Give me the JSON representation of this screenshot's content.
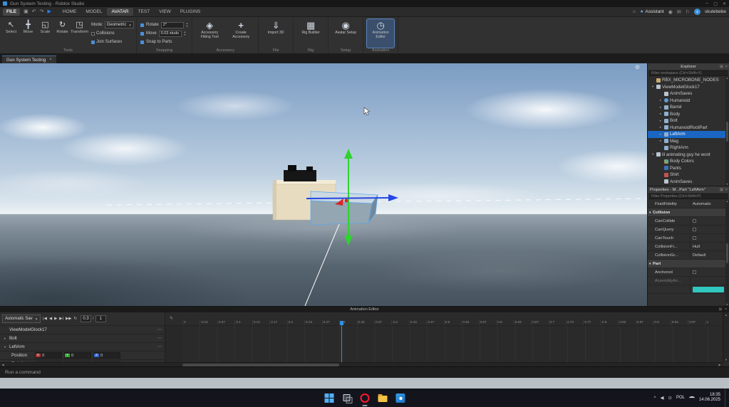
{
  "window": {
    "title": "Gun System Testing - Roblox Studio",
    "controls": {
      "minimize": "─",
      "maximize": "▢",
      "close": "✕"
    }
  },
  "colors": {
    "selection_blue": "#1a66c2",
    "gizmo_green": "#2fd32f",
    "gizmo_blue": "#2446e6",
    "gizmo_red": "#d42a2a",
    "playhead_blue": "#2e8fe8",
    "sky_top": "#7b9cc2",
    "water": "#56646f"
  },
  "menubar": {
    "file_label": "FILE",
    "tabs": [
      {
        "label": "HOME",
        "active": false
      },
      {
        "label": "MODEL",
        "active": false
      },
      {
        "label": "AVATAR",
        "active": true
      },
      {
        "label": "TEST",
        "active": false
      },
      {
        "label": "VIEW",
        "active": false
      },
      {
        "label": "PLUGINS",
        "active": false
      }
    ],
    "assistant_label": "Assistant",
    "username": "skutebebe"
  },
  "ribbon": {
    "groups": {
      "tools": "Tools",
      "snapping": "Snapping",
      "accessory": "Accessory",
      "file": "File",
      "rig": "Rig",
      "setup": "Setup",
      "animation": "Animation"
    },
    "tools": [
      {
        "label": "Select",
        "icon": "select"
      },
      {
        "label": "Move",
        "icon": "move"
      },
      {
        "label": "Scale",
        "icon": "scale"
      },
      {
        "label": "Rotate",
        "icon": "rotate"
      },
      {
        "label": "Transform",
        "icon": "transform"
      }
    ],
    "mode_label": "Mode:",
    "mode_value": "Geometric",
    "collisions_label": "Collisions",
    "collisions_checked": false,
    "join_surfaces_label": "Join Surfaces",
    "join_surfaces_checked": true,
    "snap_rotate_label": "Rotate",
    "snap_rotate_value": "2°",
    "snap_rotate_checked": true,
    "snap_move_label": "Move",
    "snap_move_value": "0.03 studs",
    "snap_move_checked": true,
    "snap_parts_label": "Snap to Parts",
    "snap_parts_checked": true,
    "big_buttons": [
      {
        "label": "Accessory Fitting Tool",
        "icon": "accessory-fitting",
        "active": false
      },
      {
        "label": "Create Accessory",
        "icon": "create-accessory",
        "active": false
      },
      {
        "label": "Import 3D",
        "icon": "import-3d",
        "active": false
      },
      {
        "label": "Rig Builder",
        "icon": "rig-builder",
        "active": false
      },
      {
        "label": "Avatar Setup",
        "icon": "avatar-setup",
        "active": false
      },
      {
        "label": "Animation Editor",
        "icon": "animation-editor",
        "active": true
      }
    ]
  },
  "doc_tab": {
    "label": "Gun System Testing",
    "close_glyph": "×"
  },
  "explorer": {
    "title": "Explorer",
    "filter_placeholder": "Filter workspace (Ctrl+Shift+X)",
    "items": [
      {
        "label": "RBX_MICROBONE_NODES",
        "icon": "folder",
        "depth": 0,
        "expand": "leaf",
        "selected": false
      },
      {
        "label": "ViewModelGlock17",
        "icon": "model",
        "depth": 0,
        "expand": "open",
        "selected": false
      },
      {
        "label": "AnimSaves",
        "icon": "model",
        "depth": 1,
        "expand": "leaf",
        "selected": false
      },
      {
        "label": "Humanoid",
        "icon": "humanoid",
        "depth": 1,
        "expand": "closed",
        "selected": false
      },
      {
        "label": "Barrel",
        "icon": "part",
        "depth": 1,
        "expand": "closed",
        "selected": false
      },
      {
        "label": "Body",
        "icon": "part",
        "depth": 1,
        "expand": "closed",
        "selected": false
      },
      {
        "label": "Bolt",
        "icon": "part",
        "depth": 1,
        "expand": "closed",
        "selected": false
      },
      {
        "label": "HumanoidRootPart",
        "icon": "part",
        "depth": 1,
        "expand": "closed",
        "selected": false
      },
      {
        "label": "LeftArm",
        "icon": "part",
        "depth": 1,
        "expand": "closed",
        "selected": true
      },
      {
        "label": "Mag",
        "icon": "part",
        "depth": 1,
        "expand": "closed",
        "selected": false
      },
      {
        "label": "RightArm",
        "icon": "part",
        "depth": 1,
        "expand": "leaf",
        "selected": false
      },
      {
        "label": "lil animating guy he wont",
        "icon": "model",
        "depth": 0,
        "expand": "open",
        "selected": false
      },
      {
        "label": "Body Colors",
        "icon": "bodycolors",
        "depth": 1,
        "expand": "leaf",
        "selected": false
      },
      {
        "label": "Pants",
        "icon": "pants",
        "depth": 1,
        "expand": "leaf",
        "selected": false
      },
      {
        "label": "Shirt",
        "icon": "shirt",
        "depth": 1,
        "expand": "leaf",
        "selected": false
      },
      {
        "label": "AnimSaves",
        "icon": "model",
        "depth": 1,
        "expand": "leaf",
        "selected": false
      }
    ]
  },
  "properties": {
    "title": "Properties - M...Part \"LeftArm\"",
    "filter_placeholder": "Filter Properties (Ctrl+Shift+P)",
    "rows": [
      {
        "type": "row",
        "label": "FluidFidelity",
        "value": "Automatic"
      },
      {
        "type": "section",
        "label": "Collision"
      },
      {
        "type": "check",
        "label": "CanCollide",
        "checked": false
      },
      {
        "type": "check",
        "label": "CanQuery",
        "checked": false
      },
      {
        "type": "check",
        "label": "CanTouch",
        "checked": false
      },
      {
        "type": "row",
        "label": "CollisionFi...",
        "value": "Hull"
      },
      {
        "type": "row",
        "label": "CollisionGr...",
        "value": "Default"
      },
      {
        "type": "section",
        "label": "Part"
      },
      {
        "type": "check",
        "label": "Anchored",
        "checked": false
      },
      {
        "type": "row",
        "label": "AssemblyAn...",
        "value": "",
        "grayed": true
      },
      {
        "type": "swatch",
        "label": "",
        "color": "#2fc7c0"
      }
    ]
  },
  "animation_editor": {
    "title": "Animation Editor",
    "save_label": "Automatic Sav",
    "transport": [
      {
        "name": "skip-to-start-button",
        "glyph": "|◀"
      },
      {
        "name": "previous-keyframe-button",
        "glyph": "◀"
      },
      {
        "name": "play-button",
        "glyph": "▶"
      },
      {
        "name": "next-keyframe-button",
        "glyph": "▶|"
      },
      {
        "name": "skip-to-end-button",
        "glyph": "▶▶"
      },
      {
        "name": "loop-button",
        "glyph": "↻"
      }
    ],
    "time_current": "0.3",
    "time_divider": "/",
    "time_total": "1",
    "axes": [
      "X",
      "Y",
      "Z"
    ],
    "tracks": {
      "rig": "ViewModelGlock17",
      "bolt": "Bolt",
      "left_arm": "LeftArm",
      "position": "Position",
      "rotation": "Rotation",
      "position_values": {
        "x": "0",
        "y": "0",
        "z": "0"
      },
      "rotation_values": {
        "x": "",
        "y": "",
        "z": ""
      }
    },
    "ruler": [
      "0",
      "0.03",
      "0.07",
      "0.1",
      "0.13",
      "0.17",
      "0.2",
      "0.23",
      "0.27",
      "0.3",
      "0.33",
      "0.37",
      "0.4",
      "0.43",
      "0.47",
      "0.5",
      "0.53",
      "0.57",
      "0.6",
      "0.63",
      "0.67",
      "0.7",
      "0.73",
      "0.77",
      "0.8",
      "0.83",
      "0.87",
      "0.9",
      "0.93",
      "0.97",
      "1"
    ]
  },
  "command_bar": {
    "placeholder": "Run a command"
  },
  "taskbar": {
    "icons": [
      {
        "name": "start-button",
        "icon": "start",
        "open": false
      },
      {
        "name": "task-view-button",
        "icon": "task-view",
        "open": false
      },
      {
        "name": "opera-browser-button",
        "icon": "opera",
        "open": true
      },
      {
        "name": "file-explorer-button",
        "icon": "file-explorer",
        "open": true
      },
      {
        "name": "roblox-studio-button",
        "icon": "roblox-studio",
        "open": true
      }
    ],
    "tray": {
      "lang": "POL",
      "time": "18:35",
      "date": "14.06.2025"
    }
  }
}
